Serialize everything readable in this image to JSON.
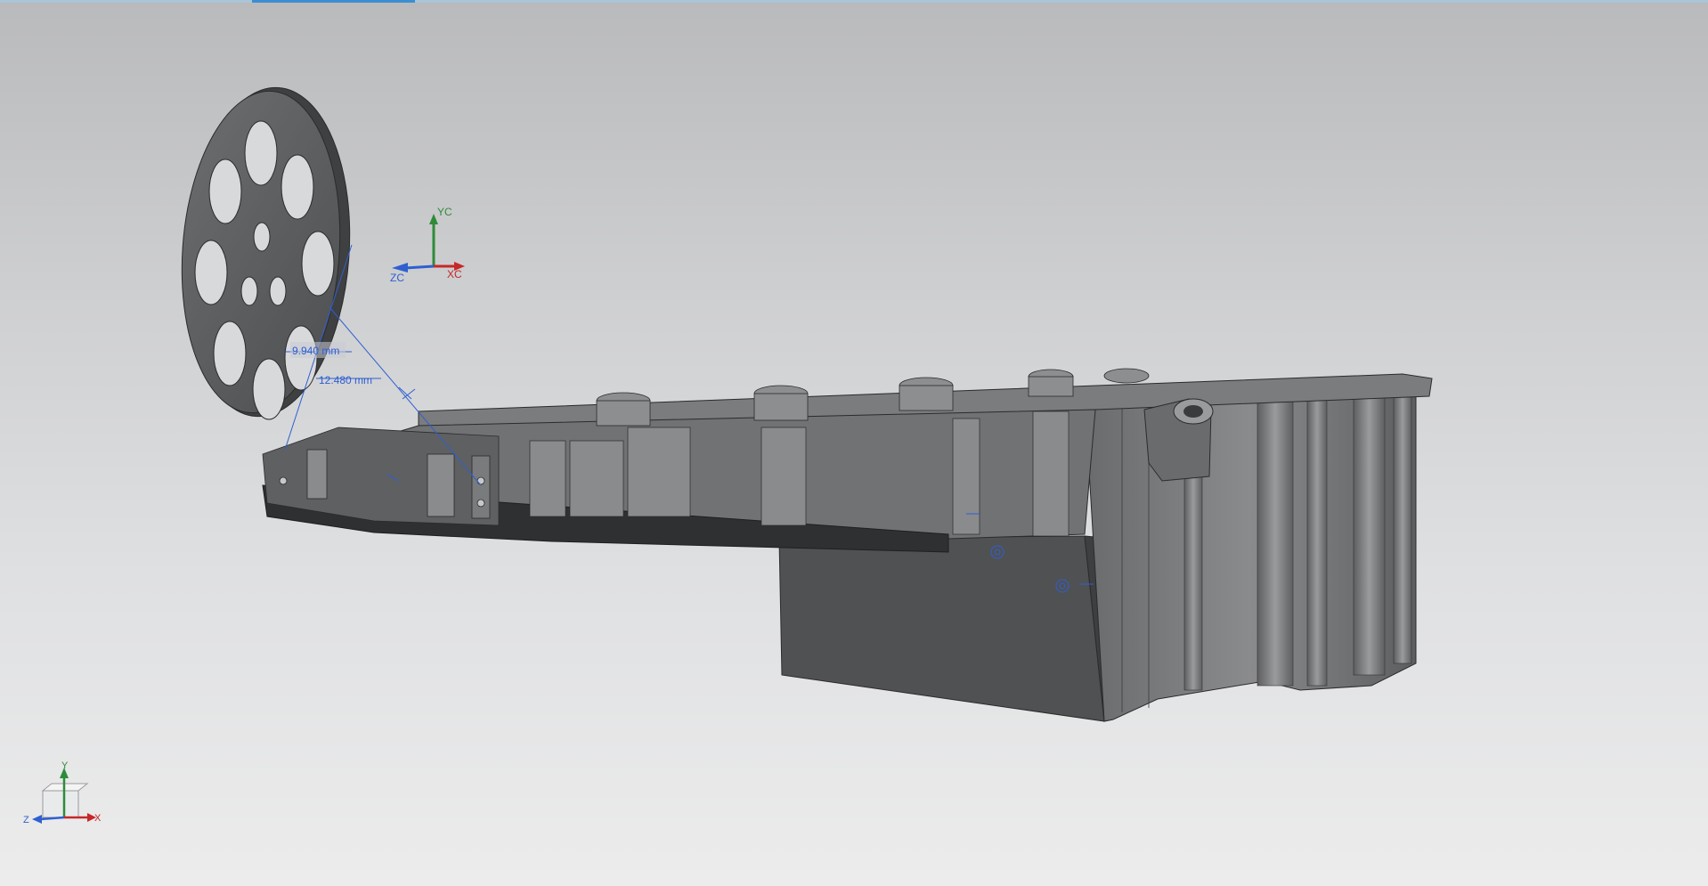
{
  "viewport": {
    "background_top": "#b9babc",
    "background_bottom": "#ececec",
    "tab_indicator_color": "#3b8fd0"
  },
  "wcs_triad": {
    "y_label": "YC",
    "x_label": "XC",
    "z_label": "ZC",
    "colors": {
      "x": "#c62828",
      "y": "#2e8b3a",
      "z": "#2f5fd0"
    }
  },
  "view_triad": {
    "y_label": "Y",
    "x_label": "X",
    "z_label": "Z"
  },
  "annotations": {
    "dimension_1": "9.940 mm",
    "dimension_2": "12.480 mm",
    "color": "#2f5fd0"
  },
  "model": {
    "name": "oil-pan-with-pickup-disc",
    "shade_color": "#6d6e70",
    "edge_color": "#2b2b2b"
  },
  "icons": [
    "wcs-triad-icon",
    "view-orientation-cube-icon",
    "dimension-arrow-icon",
    "datum-circle-icon"
  ]
}
